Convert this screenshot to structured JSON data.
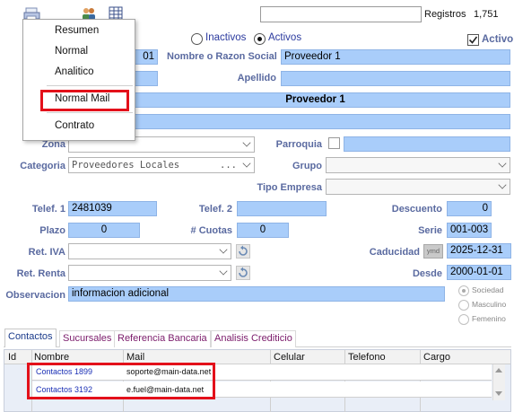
{
  "toolbar": {
    "records_label": "Registros",
    "records_count": "1,751"
  },
  "menu": {
    "items": [
      "Resumen",
      "Normal",
      "Analitico",
      "Normal Mail",
      "Contrato"
    ]
  },
  "status": {
    "inactive_label": "Inactivos",
    "active_label": "Activos",
    "active_checkbox_label": "Activo"
  },
  "form": {
    "code_value": "01",
    "name_label": "Nombre o Razon Social",
    "name_value": "Proveedor 1",
    "apellido_label": "Apellido",
    "apellido_value": "",
    "display_name": "Proveedor 1",
    "zona_label": "Zona",
    "parroquia_label": "Parroquia",
    "categoria_label": "Categoria",
    "categoria_value": "Proveedores Locales",
    "categoria_ellipsis": "...",
    "grupo_label": "Grupo",
    "tipo_empresa_label": "Tipo Empresa",
    "telef1_label": "Telef. 1",
    "telef1_value": "2481039",
    "telef2_label": "Telef. 2",
    "telef2_value": "",
    "descuento_label": "Descuento",
    "descuento_value": "0",
    "plazo_label": "Plazo",
    "plazo_value": "0",
    "cuotas_label": "# Cuotas",
    "cuotas_value": "0",
    "serie_label": "Serie",
    "serie_value": "001-003",
    "ret_iva_label": "Ret. IVA",
    "caducidad_label": "Caducidad",
    "ymd_label": "ymd",
    "caducidad_value": "2025-12-31",
    "ret_renta_label": "Ret. Renta",
    "desde_label": "Desde",
    "desde_value": "2000-01-01",
    "observacion_label": "Observacion",
    "observacion_value": "informacion adicional",
    "gender_options": [
      "Sociedad",
      "Masculino",
      "Femenino"
    ]
  },
  "tabs": [
    "Contactos",
    "Sucursales",
    "Referencia Bancaria",
    "Analisis Crediticio"
  ],
  "table": {
    "columns": [
      "Id",
      "Nombre",
      "Mail",
      "Celular",
      "Telefono",
      "Cargo"
    ],
    "rows": [
      {
        "nombre": "Contactos 1899",
        "mail": "soporte@main-data.net"
      },
      {
        "nombre": "Contactos 3192",
        "mail": "e.fuel@main-data.net"
      }
    ]
  },
  "colors": {
    "field_bg": "#a9cdfa",
    "label_color": "#5a6aa0",
    "highlight_red": "#e3101a",
    "tab_text": "#7a1a6a"
  }
}
